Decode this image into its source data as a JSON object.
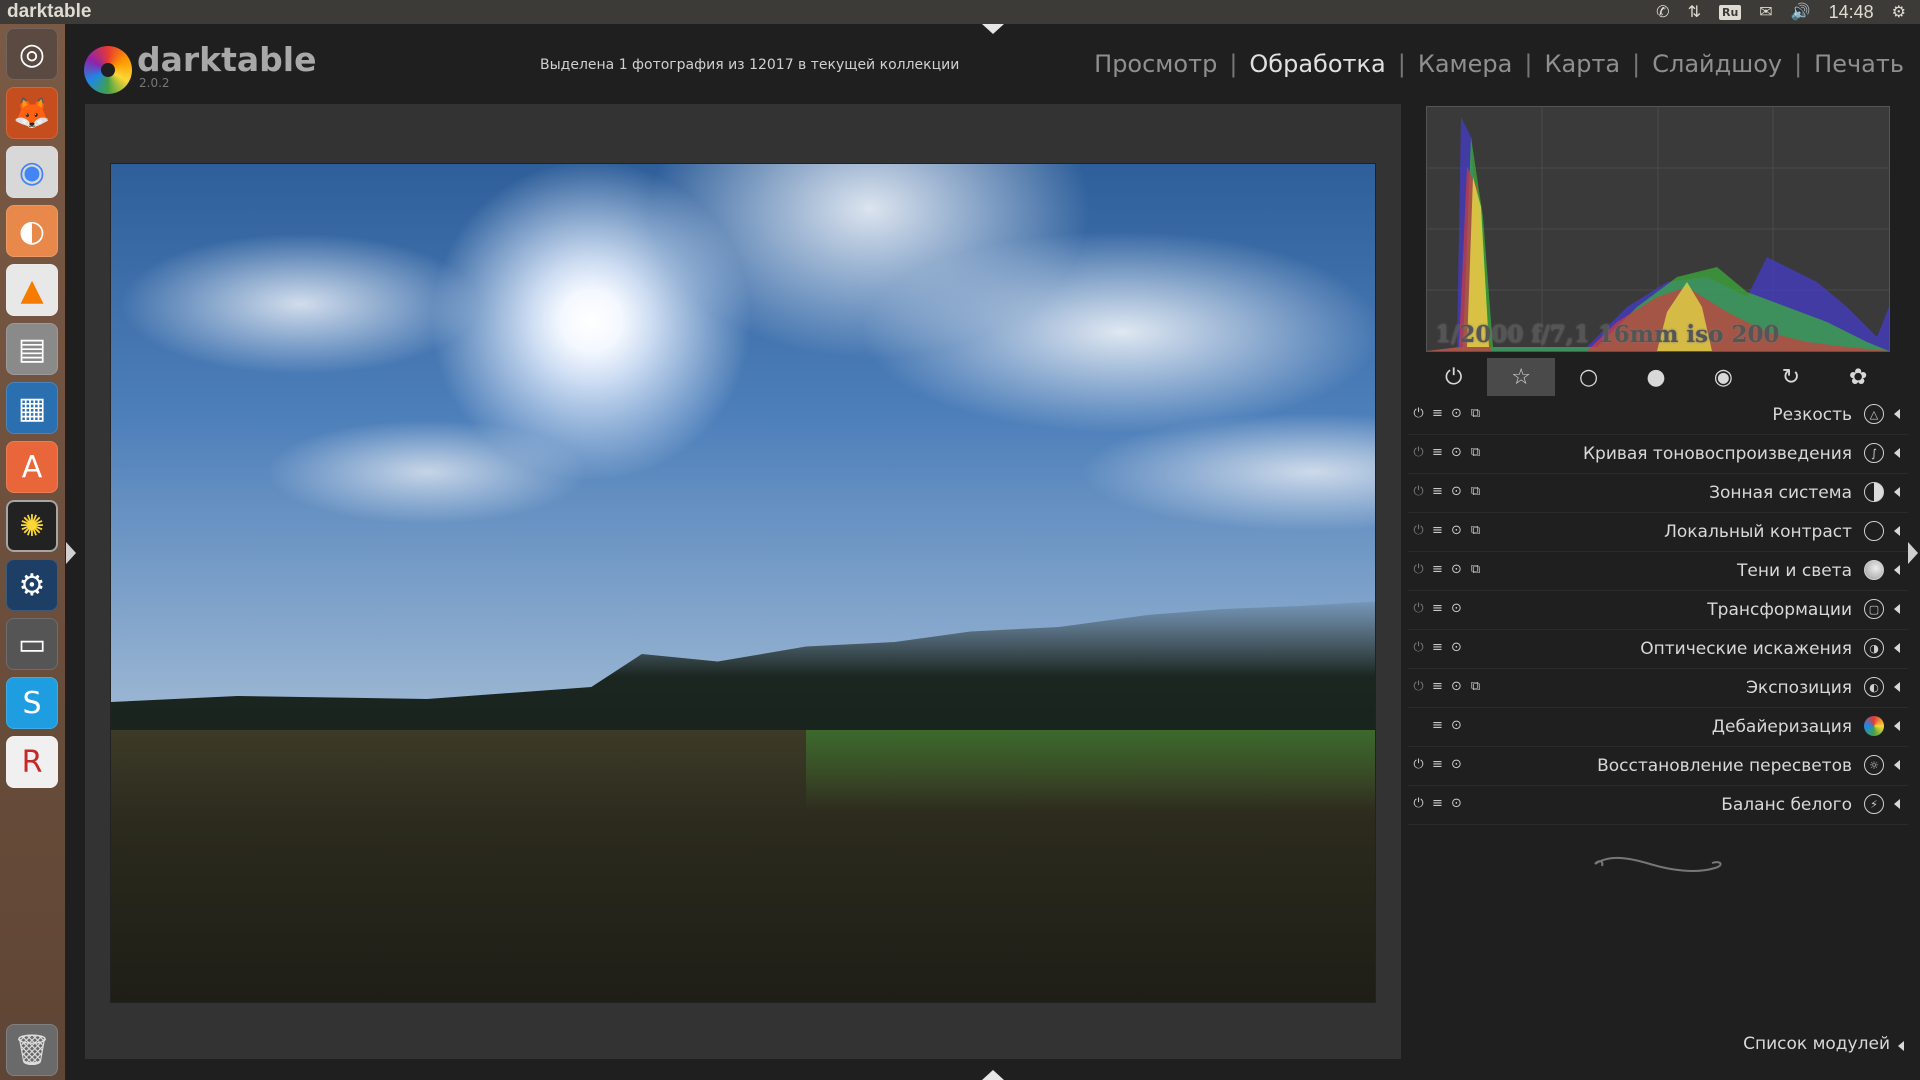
{
  "window": {
    "app_title": "darktable"
  },
  "tray": {
    "lang": "Ru",
    "time": "14:48"
  },
  "launcher": {
    "items": [
      {
        "name": "ubuntu-dash",
        "glyph": "◎"
      },
      {
        "name": "firefox",
        "glyph": "🦊"
      },
      {
        "name": "chrome",
        "glyph": "◉"
      },
      {
        "name": "app-orange",
        "glyph": "◐"
      },
      {
        "name": "vlc",
        "glyph": "▲"
      },
      {
        "name": "files",
        "glyph": "▤"
      },
      {
        "name": "writer",
        "glyph": "▦"
      },
      {
        "name": "software-center",
        "glyph": "A"
      },
      {
        "name": "darktable",
        "glyph": "✺"
      },
      {
        "name": "steam",
        "glyph": "⚙"
      },
      {
        "name": "scanner",
        "glyph": "▭"
      },
      {
        "name": "skype",
        "glyph": "S"
      },
      {
        "name": "rcmdr",
        "glyph": "R"
      },
      {
        "name": "trash",
        "glyph": "🗑"
      }
    ]
  },
  "header": {
    "logo_name": "darktable",
    "logo_version": "2.0.2",
    "collection_info": "Выделена 1 фотография из 12017 в текущей коллекции",
    "views": [
      {
        "label": "Просмотр",
        "active": false
      },
      {
        "label": "Обработка",
        "active": true
      },
      {
        "label": "Камера",
        "active": false
      },
      {
        "label": "Карта",
        "active": false
      },
      {
        "label": "Слайдшоу",
        "active": false
      },
      {
        "label": "Печать",
        "active": false
      }
    ],
    "separator": "|"
  },
  "histogram": {
    "exif": "1/2000 f/7,1 16mm iso 200"
  },
  "group_tabs": [
    {
      "name": "power",
      "glyph": "⏻",
      "active": false
    },
    {
      "name": "favorites",
      "glyph": "☆",
      "active": true
    },
    {
      "name": "basic",
      "glyph": "○",
      "active": false
    },
    {
      "name": "tone",
      "glyph": "●",
      "active": false
    },
    {
      "name": "color",
      "glyph": "◉",
      "active": false
    },
    {
      "name": "correct",
      "glyph": "↻",
      "active": false
    },
    {
      "name": "effects",
      "glyph": "✿",
      "active": false
    }
  ],
  "modules": [
    {
      "label": "Резкость",
      "icon": "triangle",
      "glyph": "△",
      "style": "",
      "power": true,
      "presets": true
    },
    {
      "label": "Кривая тоновоспроизведения",
      "icon": "curve",
      "glyph": "∫",
      "style": "",
      "power": false,
      "presets": true
    },
    {
      "label": "Зонная система",
      "icon": "zones",
      "glyph": "",
      "style": "half",
      "power": false,
      "presets": true
    },
    {
      "label": "Локальный контраст",
      "icon": "circle",
      "glyph": "",
      "style": "",
      "power": false,
      "presets": true
    },
    {
      "label": "Тени и света",
      "icon": "sphere",
      "glyph": "",
      "style": "filled",
      "power": false,
      "presets": true
    },
    {
      "label": "Трансформации",
      "icon": "crop",
      "glyph": "▢",
      "style": "",
      "power": false,
      "presets": false
    },
    {
      "label": "Оптические искажения",
      "icon": "lens",
      "glyph": "◑",
      "style": "",
      "power": false,
      "presets": false
    },
    {
      "label": "Экспозиция",
      "icon": "exposure",
      "glyph": "◐",
      "style": "",
      "power": false,
      "presets": true
    },
    {
      "label": "Дебайеризация",
      "icon": "demosaic",
      "glyph": "",
      "style": "color",
      "power": null,
      "presets": false
    },
    {
      "label": "Восстановление пересветов",
      "icon": "highlight",
      "glyph": "☼",
      "style": "",
      "power": true,
      "presets": false
    },
    {
      "label": "Баланс белого",
      "icon": "wb",
      "glyph": "⚡",
      "style": "",
      "power": true,
      "presets": false
    }
  ],
  "module_ctrl_glyphs": {
    "power": "⏻",
    "multi": "≡",
    "reset": "⊙",
    "presets": "⧉"
  },
  "footer": {
    "module_list_label": "Список модулей"
  },
  "colors": {
    "panel_bg": "#1f1f1f",
    "center_bg": "#333333",
    "accent_text": "#d8d8d8"
  }
}
